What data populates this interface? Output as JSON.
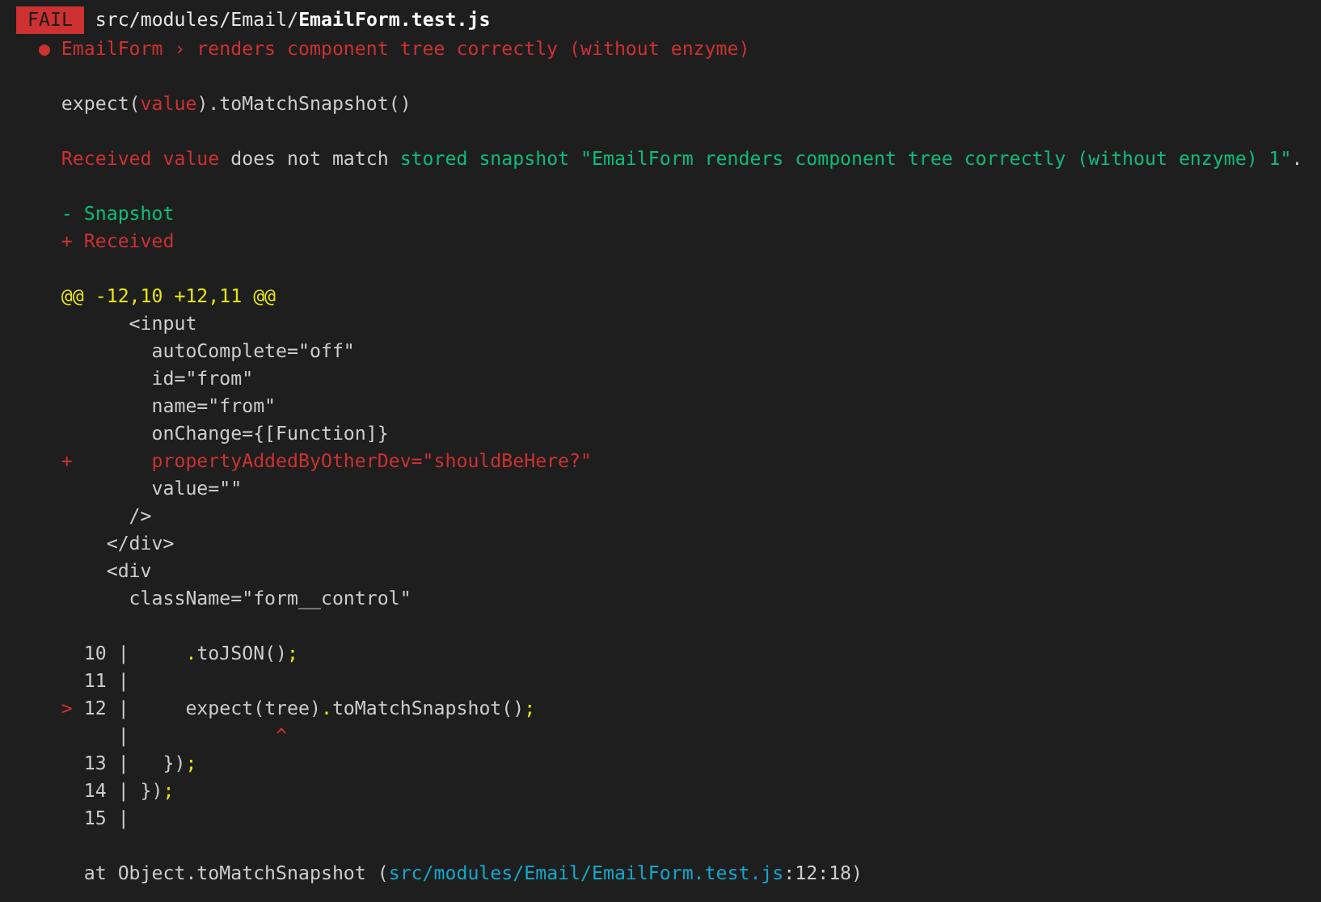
{
  "header": {
    "badge": "FAIL",
    "path_dir": "src/modules/Email/",
    "path_file": "EmailForm.test.js"
  },
  "lines": [
    {
      "kind": "text",
      "segments": [
        {
          "kind": "red",
          "text": "  ● EmailForm › renders component tree correctly (without enzyme)"
        }
      ]
    },
    {
      "kind": "blank"
    },
    {
      "kind": "text",
      "segments": [
        {
          "kind": "plain",
          "text": "    expect("
        },
        {
          "kind": "red",
          "text": "value"
        },
        {
          "kind": "plain",
          "text": ").toMatchSnapshot()"
        }
      ]
    },
    {
      "kind": "blank"
    },
    {
      "kind": "text",
      "segments": [
        {
          "kind": "red",
          "text": "    Received value"
        },
        {
          "kind": "plain",
          "text": " does not match "
        },
        {
          "kind": "green",
          "text": "stored snapshot \"EmailForm renders component tree correctly (without enzyme) 1\""
        },
        {
          "kind": "plain",
          "text": "."
        }
      ]
    },
    {
      "kind": "blank"
    },
    {
      "kind": "text",
      "segments": [
        {
          "kind": "green",
          "text": "    - Snapshot"
        }
      ]
    },
    {
      "kind": "text",
      "segments": [
        {
          "kind": "red",
          "text": "    + Received"
        }
      ]
    },
    {
      "kind": "blank"
    },
    {
      "kind": "text",
      "segments": [
        {
          "kind": "yellow",
          "text": "    @@ -12,10 +12,11 @@"
        }
      ]
    },
    {
      "kind": "text",
      "segments": [
        {
          "kind": "plain",
          "text": "          <input"
        }
      ]
    },
    {
      "kind": "text",
      "segments": [
        {
          "kind": "plain",
          "text": "            autoComplete=\"off\""
        }
      ]
    },
    {
      "kind": "text",
      "segments": [
        {
          "kind": "plain",
          "text": "            id=\"from\""
        }
      ]
    },
    {
      "kind": "text",
      "segments": [
        {
          "kind": "plain",
          "text": "            name=\"from\""
        }
      ]
    },
    {
      "kind": "text",
      "segments": [
        {
          "kind": "plain",
          "text": "            onChange={[Function]}"
        }
      ]
    },
    {
      "kind": "text",
      "segments": [
        {
          "kind": "red",
          "text": "    +       propertyAddedByOtherDev=\"shouldBeHere?\""
        }
      ]
    },
    {
      "kind": "text",
      "segments": [
        {
          "kind": "plain",
          "text": "            value=\"\""
        }
      ]
    },
    {
      "kind": "text",
      "segments": [
        {
          "kind": "plain",
          "text": "          />"
        }
      ]
    },
    {
      "kind": "text",
      "segments": [
        {
          "kind": "plain",
          "text": "        </div>"
        }
      ]
    },
    {
      "kind": "text",
      "segments": [
        {
          "kind": "plain",
          "text": "        <div"
        }
      ]
    },
    {
      "kind": "text",
      "segments": [
        {
          "kind": "plain",
          "text": "          className=\"form__control\""
        }
      ]
    },
    {
      "kind": "blank"
    },
    {
      "kind": "text",
      "segments": [
        {
          "kind": "plain",
          "text": "      10 |     "
        },
        {
          "kind": "yellow",
          "text": "."
        },
        {
          "kind": "plain",
          "text": "toJSON()"
        },
        {
          "kind": "yellow",
          "text": ";"
        }
      ]
    },
    {
      "kind": "text",
      "segments": [
        {
          "kind": "plain",
          "text": "      11 |"
        }
      ]
    },
    {
      "kind": "text",
      "segments": [
        {
          "kind": "red",
          "text": "    >"
        },
        {
          "kind": "plain",
          "text": " 12 |     expect(tree)"
        },
        {
          "kind": "yellow",
          "text": "."
        },
        {
          "kind": "plain",
          "text": "toMatchSnapshot()"
        },
        {
          "kind": "yellow",
          "text": ";"
        }
      ]
    },
    {
      "kind": "text",
      "segments": [
        {
          "kind": "plain",
          "text": "         |             "
        },
        {
          "kind": "red",
          "text": "^"
        }
      ]
    },
    {
      "kind": "text",
      "segments": [
        {
          "kind": "plain",
          "text": "      13 |   })"
        },
        {
          "kind": "yellow",
          "text": ";"
        }
      ]
    },
    {
      "kind": "text",
      "segments": [
        {
          "kind": "plain",
          "text": "      14 | })"
        },
        {
          "kind": "yellow",
          "text": ";"
        }
      ]
    },
    {
      "kind": "text",
      "segments": [
        {
          "kind": "plain",
          "text": "      15 |"
        }
      ]
    },
    {
      "kind": "blank"
    },
    {
      "kind": "text",
      "segments": [
        {
          "kind": "plain",
          "text": "      at Object.toMatchSnapshot ("
        },
        {
          "kind": "cyan",
          "text": "src/modules/Email/EmailForm.test.js"
        },
        {
          "kind": "plain",
          "text": ":12:18)"
        }
      ]
    }
  ]
}
